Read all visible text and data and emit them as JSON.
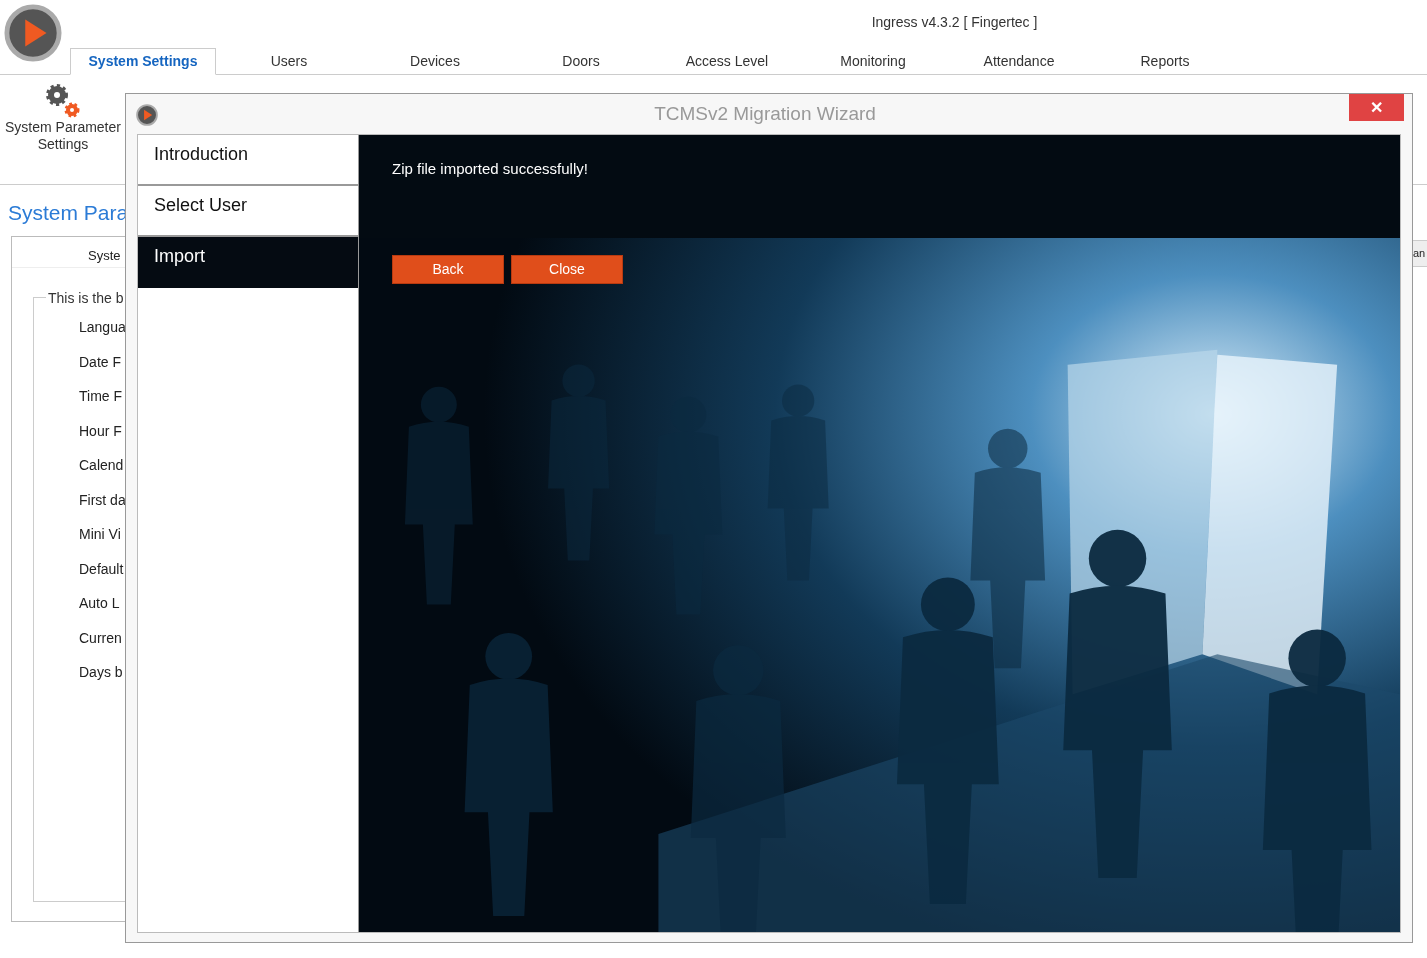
{
  "app": {
    "title": "Ingress v4.3.2 [ Fingertec ]"
  },
  "tabs": [
    {
      "label": "System Settings",
      "selected": true
    },
    {
      "label": "Users",
      "selected": false
    },
    {
      "label": "Devices",
      "selected": false
    },
    {
      "label": "Doors",
      "selected": false
    },
    {
      "label": "Access Level",
      "selected": false
    },
    {
      "label": "Monitoring",
      "selected": false
    },
    {
      "label": "Attendance",
      "selected": false
    },
    {
      "label": "Reports",
      "selected": false
    }
  ],
  "ribbon": {
    "button": "System Parameter Settings"
  },
  "page": {
    "heading": "System Para",
    "panel_header": "Syste",
    "group_title": "This is the b",
    "fields": [
      "Langua",
      "Date F",
      "Time F",
      "Hour F",
      "Calend",
      "First da",
      "Mini Vi",
      "Default",
      "Auto L",
      "Curren",
      "Days b"
    ],
    "right_button": "an"
  },
  "dialog": {
    "title": "TCMSv2 Migration Wizard",
    "close": "✕",
    "steps": [
      {
        "label": "Introduction",
        "selected": false
      },
      {
        "label": "Select User",
        "selected": false
      },
      {
        "label": "Import",
        "selected": true
      }
    ],
    "message": "Zip file imported successfully!",
    "buttons": [
      "Back",
      "Close"
    ]
  }
}
